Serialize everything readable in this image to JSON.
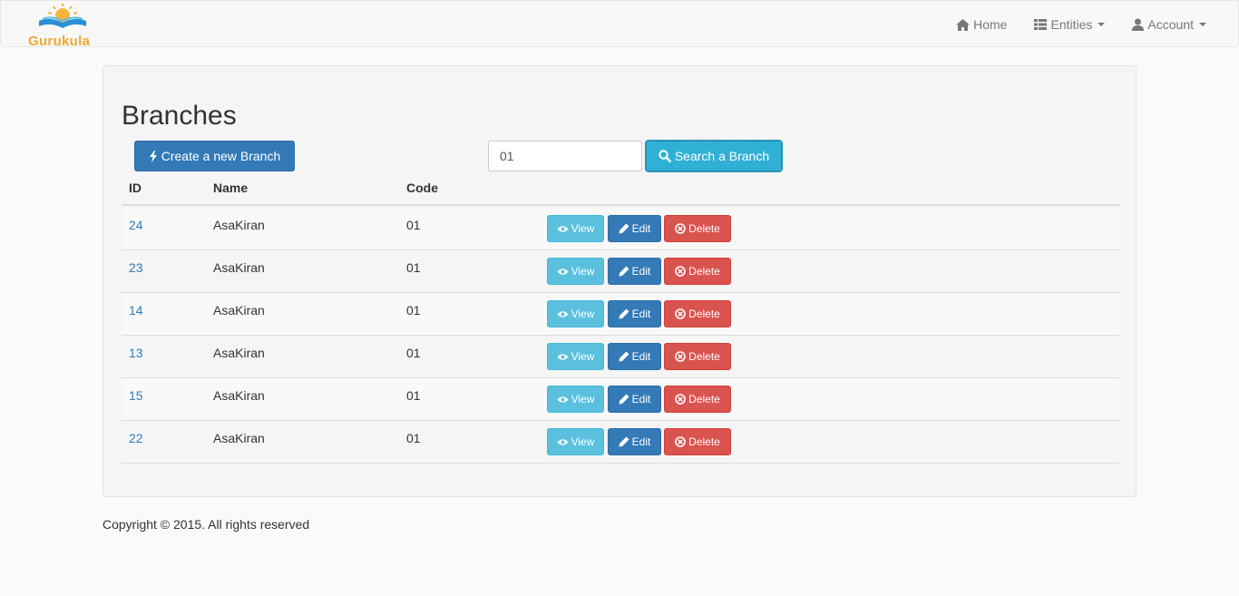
{
  "brand": {
    "name": "Gurukula"
  },
  "nav": {
    "home": "Home",
    "entities": "Entities",
    "account": "Account"
  },
  "page": {
    "title": "Branches"
  },
  "actions": {
    "create_label": "Create a new Branch",
    "search_value": "01",
    "search_label": "Search a Branch"
  },
  "table": {
    "headers": {
      "id": "ID",
      "name": "Name",
      "code": "Code"
    },
    "rows": [
      {
        "id": "24",
        "name": "AsaKiran",
        "code": "01"
      },
      {
        "id": "23",
        "name": "AsaKiran",
        "code": "01"
      },
      {
        "id": "14",
        "name": "AsaKiran",
        "code": "01"
      },
      {
        "id": "13",
        "name": "AsaKiran",
        "code": "01"
      },
      {
        "id": "15",
        "name": "AsaKiran",
        "code": "01"
      },
      {
        "id": "22",
        "name": "AsaKiran",
        "code": "01"
      }
    ],
    "row_actions": {
      "view": "View",
      "edit": "Edit",
      "delete": "Delete"
    }
  },
  "footer": {
    "text": "Copyright © 2015. All rights reserved"
  },
  "icons": {
    "home": "home-icon",
    "entities": "list-icon",
    "account": "user-icon",
    "create": "bolt-icon",
    "search": "search-icon",
    "view": "eye-icon",
    "edit": "pencil-icon",
    "delete": "remove-circle-icon"
  },
  "colors": {
    "primary": "#337ab7",
    "info": "#5bc0de",
    "danger": "#d9534f",
    "brand": "#f0a830"
  }
}
